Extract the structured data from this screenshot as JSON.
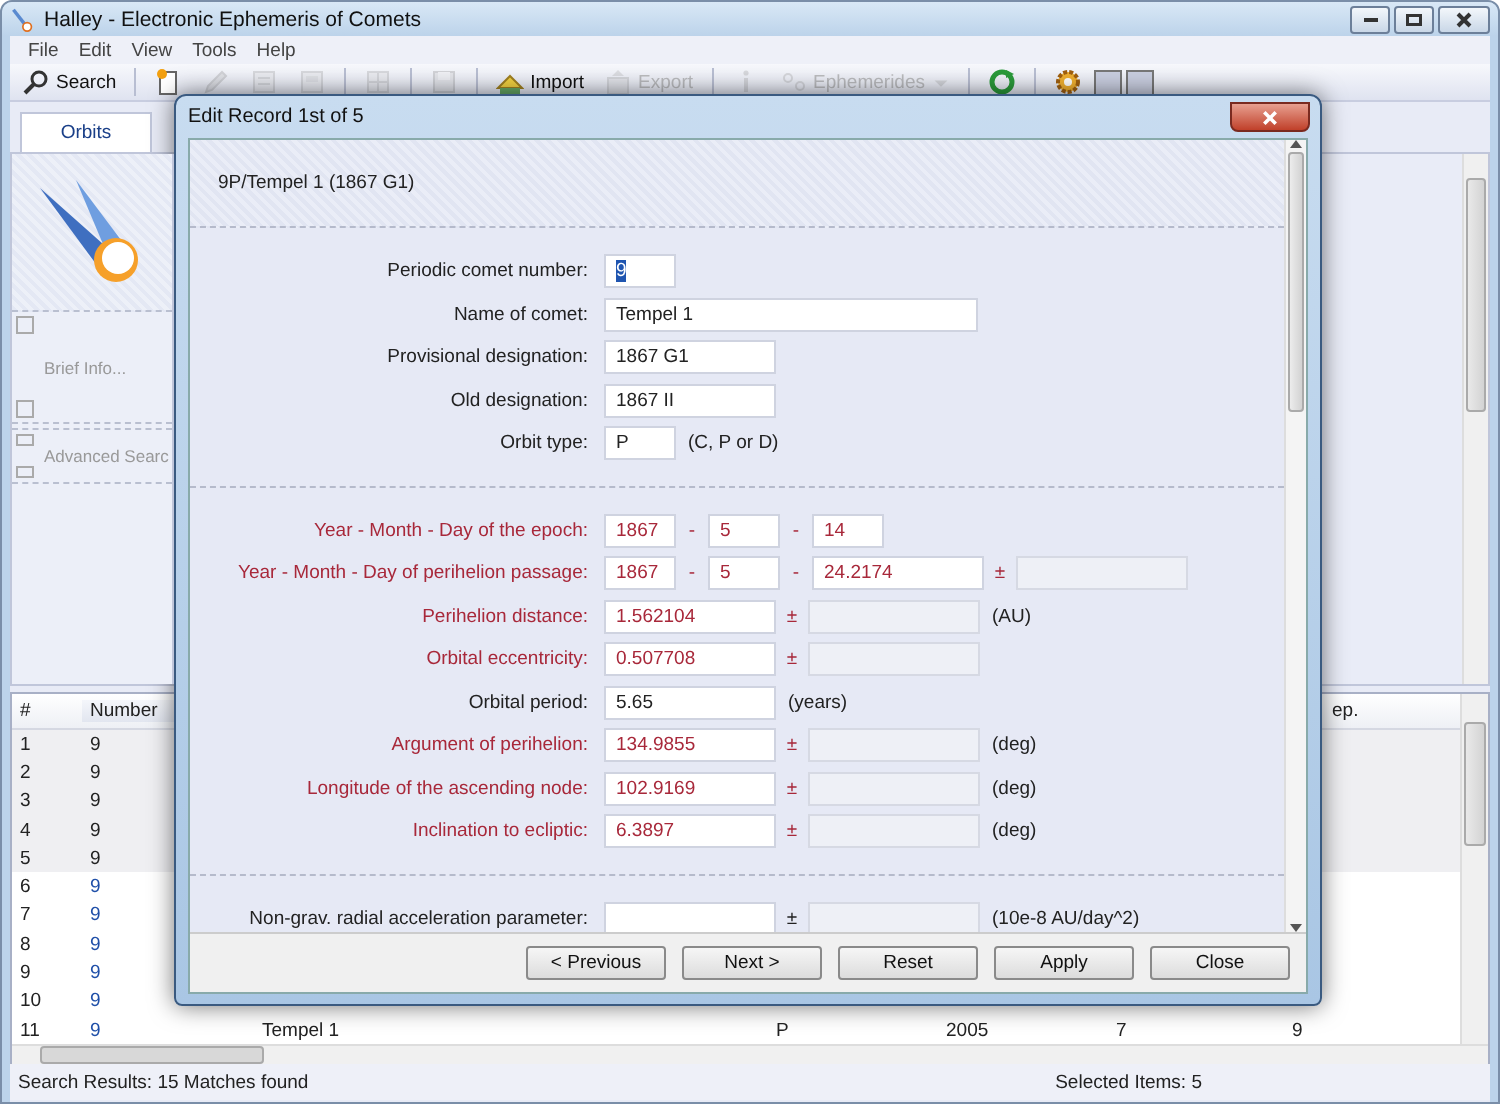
{
  "window": {
    "title": "Halley - Electronic Ephemeris of Comets"
  },
  "menu": [
    "File",
    "Edit",
    "View",
    "Tools",
    "Help"
  ],
  "toolbar": [
    {
      "kind": "button",
      "label": "Search",
      "disabled": false
    },
    {
      "kind": "separator"
    },
    {
      "kind": "icon",
      "disabled": false
    },
    {
      "kind": "icon",
      "disabled": true
    },
    {
      "kind": "icon",
      "disabled": true
    },
    {
      "kind": "icon",
      "disabled": true
    },
    {
      "kind": "separator"
    },
    {
      "kind": "icon",
      "disabled": true
    },
    {
      "kind": "separator"
    },
    {
      "kind": "icon",
      "disabled": true
    },
    {
      "kind": "separator"
    },
    {
      "kind": "button",
      "label": "Import",
      "disabled": false
    },
    {
      "kind": "button",
      "label": "Export",
      "disabled": true
    },
    {
      "kind": "separator"
    },
    {
      "kind": "icon",
      "disabled": true
    },
    {
      "kind": "dropdown",
      "label": "Ephemerides",
      "disabled": true
    },
    {
      "kind": "separator"
    },
    {
      "kind": "icon",
      "disabled": false
    },
    {
      "kind": "separator"
    },
    {
      "kind": "icon",
      "disabled": false
    },
    {
      "kind": "toggle",
      "pressed": true
    },
    {
      "kind": "toggle",
      "pressed": true
    }
  ],
  "tabs": [
    {
      "label": "Orbits",
      "selected": true
    }
  ],
  "side_panel": {
    "sections": [
      "Brief Info...",
      "Advanced Searc"
    ]
  },
  "table": {
    "headers": {
      "index": {
        "label": "#",
        "sorted": false
      },
      "number": {
        "label": "Number",
        "sorted": true
      },
      "column_9": {
        "label": "ep.",
        "sorted": false
      }
    },
    "rows": [
      {
        "selected": true,
        "index": "1",
        "number": "9"
      },
      {
        "selected": true,
        "index": "2",
        "number": "9"
      },
      {
        "selected": true,
        "index": "3",
        "number": "9"
      },
      {
        "selected": true,
        "index": "4",
        "number": "9"
      },
      {
        "selected": true,
        "index": "5",
        "number": "9"
      },
      {
        "selected": false,
        "index": "6",
        "number": "9"
      },
      {
        "selected": false,
        "index": "7",
        "number": "9"
      },
      {
        "selected": false,
        "index": "8",
        "number": "9"
      },
      {
        "selected": false,
        "index": "9",
        "number": "9"
      },
      {
        "selected": false,
        "index": "10",
        "number": "9"
      },
      {
        "selected": false,
        "index": "11",
        "number": "9",
        "column_3": "Tempel 1",
        "column_6": "P",
        "column_7": "2005",
        "column_8": "7",
        "column_9": "9"
      }
    ]
  },
  "status_bar": {
    "results": "Search Results: 15 Matches found",
    "selected": "Selected Items: 5"
  },
  "dialog": {
    "title": "Edit Record 1st of 5",
    "heading": "9P/Tempel 1 (1867 G1)",
    "sections": [
      [
        {
          "label": "Periodic comet number:",
          "required": false,
          "inputs": [
            {
              "kind": "short",
              "value": "9",
              "selected": true
            }
          ]
        },
        {
          "label": "Name of comet:",
          "required": false,
          "inputs": [
            {
              "kind": "long",
              "value": "Tempel 1"
            }
          ]
        },
        {
          "label": "Provisional designation:",
          "required": false,
          "inputs": [
            {
              "kind": "medium",
              "value": "1867 G1"
            }
          ]
        },
        {
          "label": "Old designation:",
          "required": false,
          "inputs": [
            {
              "kind": "medium",
              "value": "1867 II"
            }
          ]
        },
        {
          "label": "Orbit type:",
          "required": false,
          "inputs": [
            {
              "kind": "short",
              "value": "P"
            }
          ],
          "unit": "(C, P or D)"
        }
      ],
      [
        {
          "label": "Year - Month - Day of the epoch:",
          "required": true,
          "inputs": [
            {
              "kind": "short",
              "value": "1867"
            },
            {
              "prefix": "-",
              "kind": "short",
              "value": "5"
            },
            {
              "prefix": "-",
              "kind": "short",
              "value": "14"
            }
          ]
        },
        {
          "label": "Year - Month - Day of perihelion passage:",
          "required": true,
          "inputs": [
            {
              "kind": "short",
              "value": "1867"
            },
            {
              "prefix": "-",
              "kind": "short",
              "value": "5"
            },
            {
              "prefix": "-",
              "kind": "medium",
              "value": "24.2174"
            },
            {
              "prefix": "±",
              "kind": "medium",
              "disabled": true
            }
          ]
        },
        {
          "label": "Perihelion distance:",
          "required": true,
          "inputs": [
            {
              "kind": "medium",
              "value": "1.562104"
            },
            {
              "prefix": "±",
              "kind": "medium",
              "disabled": true
            }
          ],
          "unit": "(AU)"
        },
        {
          "label": "Orbital eccentricity:",
          "required": true,
          "inputs": [
            {
              "kind": "medium",
              "value": "0.507708"
            },
            {
              "prefix": "±",
              "kind": "medium",
              "disabled": true
            }
          ]
        },
        {
          "label": "Orbital period:",
          "required": false,
          "inputs": [
            {
              "kind": "medium",
              "value": "5.65"
            }
          ],
          "unit": "(years)"
        },
        {
          "label": "Argument of perihelion:",
          "required": true,
          "inputs": [
            {
              "kind": "medium",
              "value": "134.9855"
            },
            {
              "prefix": "±",
              "kind": "medium",
              "disabled": true
            }
          ],
          "unit": "(deg)"
        },
        {
          "label": "Longitude of the ascending node:",
          "required": true,
          "inputs": [
            {
              "kind": "medium",
              "value": "102.9169"
            },
            {
              "prefix": "±",
              "kind": "medium",
              "disabled": true
            }
          ],
          "unit": "(deg)"
        },
        {
          "label": "Inclination to ecliptic:",
          "required": true,
          "inputs": [
            {
              "kind": "medium",
              "value": "6.3897"
            },
            {
              "prefix": "±",
              "kind": "medium",
              "disabled": true
            }
          ],
          "unit": "(deg)"
        }
      ],
      [
        {
          "label": "Non-grav. radial acceleration parameter:",
          "required": false,
          "inputs": [
            {
              "kind": "medium"
            },
            {
              "prefix": "±",
              "kind": "medium",
              "disabled": true
            }
          ],
          "unit": "(10e-8 AU/day^2)"
        }
      ]
    ],
    "buttons": [
      "< Previous",
      "Next >",
      "Reset",
      "Apply",
      "Close"
    ]
  }
}
